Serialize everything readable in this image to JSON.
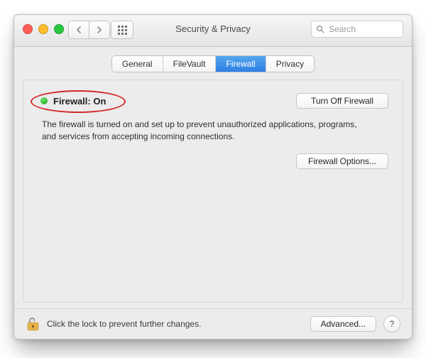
{
  "window": {
    "title": "Security & Privacy"
  },
  "search": {
    "placeholder": "Search"
  },
  "tabs": {
    "general": "General",
    "filevault": "FileVault",
    "firewall": "Firewall",
    "privacy": "Privacy",
    "active": "firewall"
  },
  "firewall": {
    "status_label": "Firewall: On",
    "status_color": "#1aa31a",
    "turn_off_label": "Turn Off Firewall",
    "description": "The firewall is turned on and set up to prevent unauthorized applications, programs, and services from accepting incoming connections.",
    "options_label": "Firewall Options..."
  },
  "footer": {
    "lock_text": "Click the lock to prevent further changes.",
    "advanced_label": "Advanced...",
    "help_label": "?"
  },
  "annotation": {
    "highlight": "status"
  }
}
